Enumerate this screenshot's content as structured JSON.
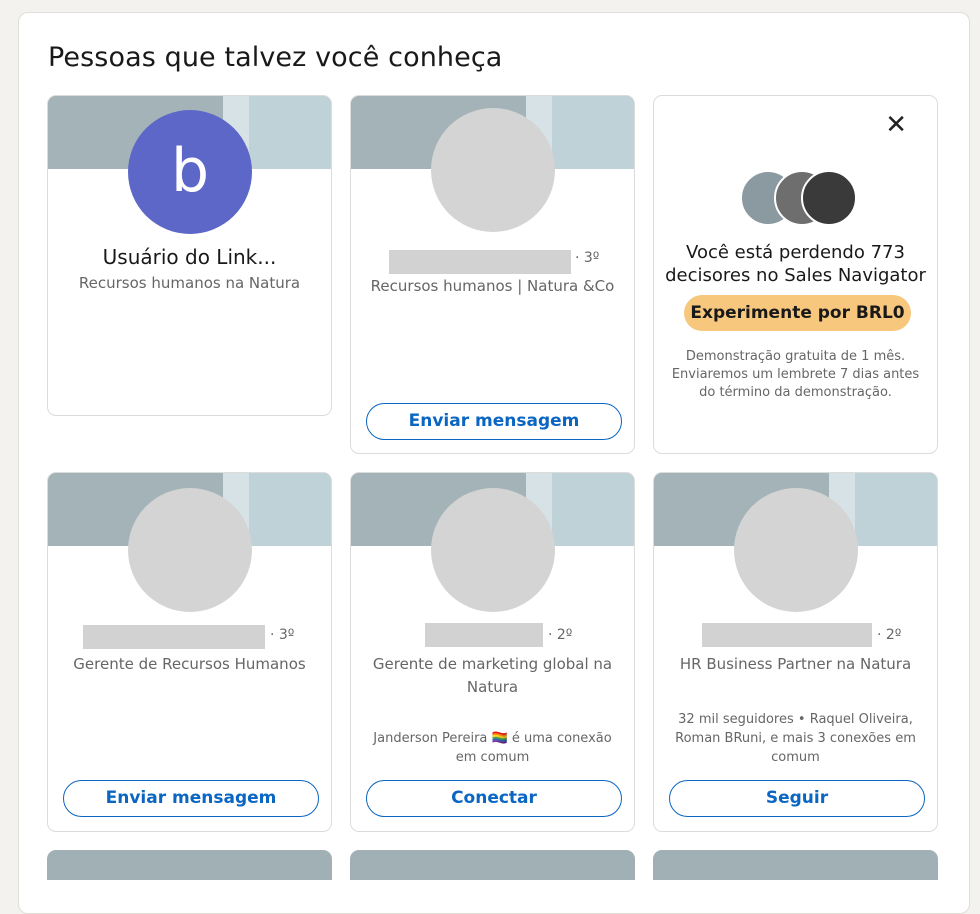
{
  "section": {
    "title": "Pessoas que talvez você conheça"
  },
  "cards": [
    {
      "name": "Usuário do Link...",
      "subtitle": "Recursos humanos na Natura",
      "avatar_letter": "b"
    },
    {
      "degree": "· 3º",
      "subtitle": "Recursos humanos | Natura &Co",
      "button": "Enviar mensagem"
    },
    {
      "degree": "· 3º",
      "subtitle": "Gerente de Recursos Humanos",
      "button": "Enviar mensagem"
    },
    {
      "degree": "· 2º",
      "subtitle": "Gerente de marketing global na Natura",
      "mutual": "Janderson Pereira 🏳️‍🌈 é uma conexão em comum",
      "button": "Conectar"
    },
    {
      "degree": "· 2º",
      "subtitle": "HR Business Partner na Natura",
      "mutual": "32 mil seguidores • Raquel Oliveira, Roman BRuni, e mais 3 conexões em comum",
      "button": "Seguir"
    }
  ],
  "promo": {
    "title": "Você está perdendo 773 decisores no Sales Navigator",
    "button": "Experimente por BRL0",
    "note": "Demonstração gratuita de 1 mês. Enviaremos um lembrete 7 dias antes do término da demonstração.",
    "close_icon": "close-icon"
  },
  "colors": {
    "accent": "#0a66c2",
    "promo_button": "#f8c77e",
    "letter_avatar": "#5c67c8"
  }
}
